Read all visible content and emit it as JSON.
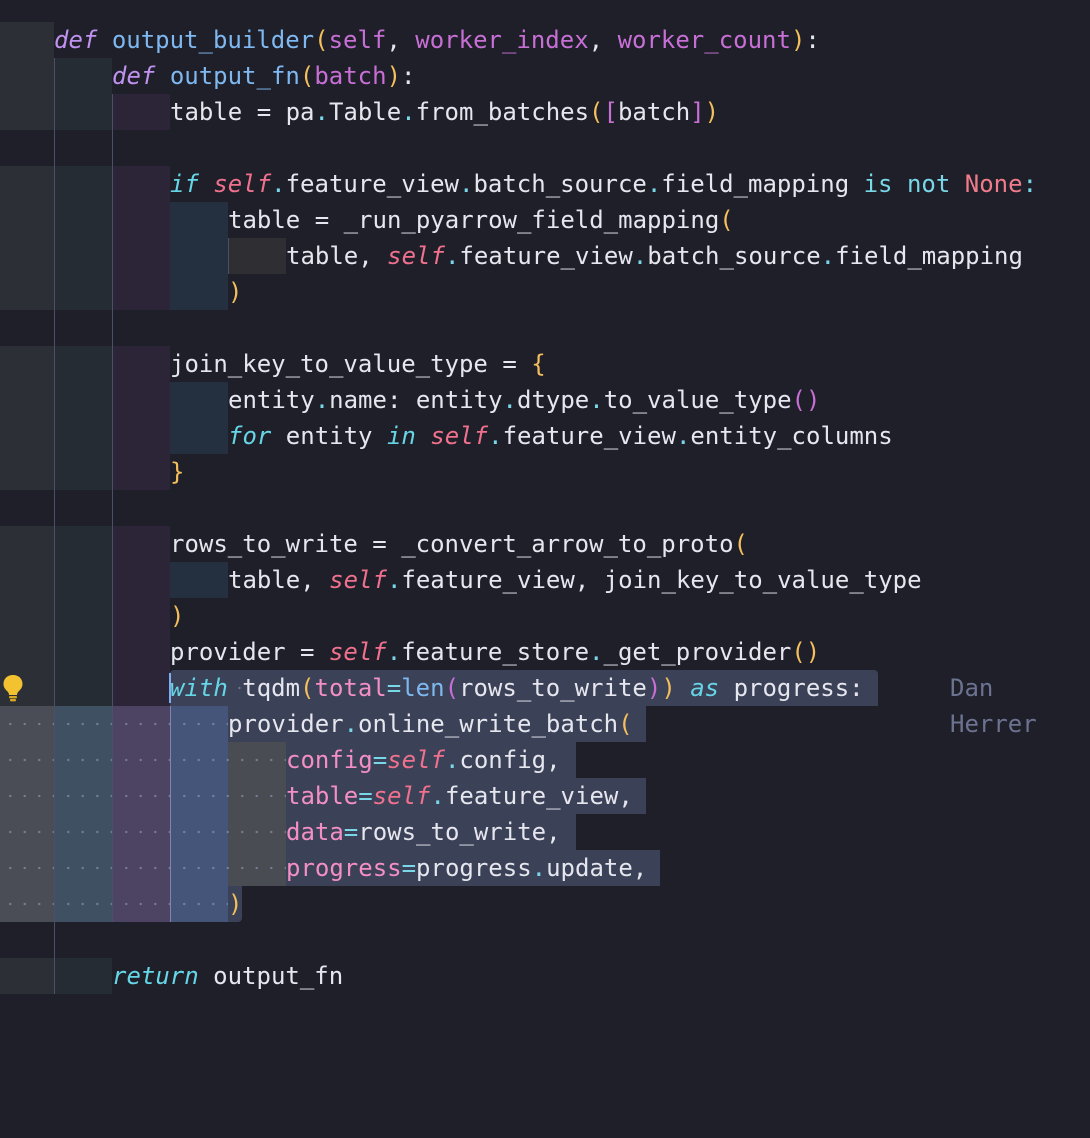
{
  "editor": {
    "blame": "Dan Herrer",
    "lightbulb": "lightbulb-icon"
  },
  "code": {
    "l1": [
      "def",
      "output_builder",
      "(",
      "self",
      ", ",
      "worker_index",
      ", ",
      "worker_count",
      ")",
      ":"
    ],
    "l2": [
      "def",
      "output_fn",
      "(",
      "batch",
      ")",
      ":"
    ],
    "l3": [
      "table = pa",
      ".",
      "Table",
      ".",
      "from_batches",
      "(",
      "[",
      "batch",
      "]",
      ")"
    ],
    "l5": [
      "if",
      " ",
      "self",
      ".",
      "feature_view",
      ".",
      "batch_source",
      ".",
      "field_mapping ",
      "is",
      " ",
      "not",
      " ",
      "None",
      ":"
    ],
    "l6": [
      "table = _run_pyarrow_field_mapping",
      "("
    ],
    "l7": [
      "table, ",
      "self",
      ".",
      "feature_view",
      ".",
      "batch_source",
      ".",
      "field_mapping"
    ],
    "l8": [
      ")"
    ],
    "l10": [
      "join_key_to_value_type = ",
      "{"
    ],
    "l11": [
      "entity",
      ".",
      "name: entity",
      ".",
      "dtype",
      ".",
      "to_value_type",
      "()"
    ],
    "l12": [
      "for",
      " entity ",
      "in",
      " ",
      "self",
      ".",
      "feature_view",
      ".",
      "entity_columns"
    ],
    "l13": [
      "}"
    ],
    "l15": [
      "rows_to_write = _convert_arrow_to_proto",
      "("
    ],
    "l16": [
      "table, ",
      "self",
      ".",
      "feature_view, join_key_to_value_type"
    ],
    "l17": [
      ")"
    ],
    "l18": [
      "provider = ",
      "self",
      ".",
      "feature_store",
      ".",
      "_get_provider",
      "()"
    ],
    "l19": [
      "with",
      " tqdm",
      "(",
      "total",
      "=",
      "len",
      "(",
      "rows_to_write",
      ")",
      ")",
      " ",
      "as",
      " progress:"
    ],
    "l20": [
      "provider",
      ".",
      "online_write_batch",
      "("
    ],
    "l21": [
      "config",
      "=",
      "self",
      ".",
      "config,"
    ],
    "l22": [
      "table",
      "=",
      "self",
      ".",
      "feature_view,"
    ],
    "l23": [
      "data",
      "=",
      "rows_to_write,"
    ],
    "l24": [
      "progress",
      "=",
      "progress",
      ".",
      "update,"
    ],
    "l25": [
      ")"
    ],
    "l27": [
      "return",
      " output_fn"
    ]
  }
}
